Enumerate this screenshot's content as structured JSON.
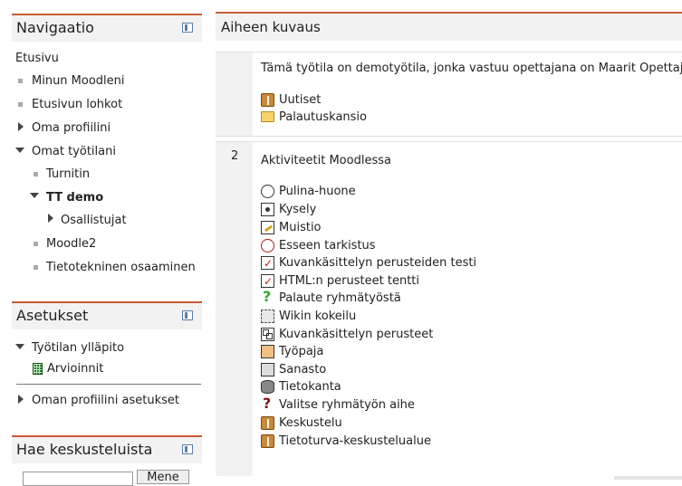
{
  "navigation": {
    "title": "Navigaatio",
    "items": [
      {
        "label": "Etusivu"
      },
      {
        "label": "Minun Moodleni"
      },
      {
        "label": "Etusivun lohkot"
      },
      {
        "label": "Oma profiilini"
      },
      {
        "label": "Omat työtilani"
      },
      {
        "label": "Turnitin"
      },
      {
        "label": "TT demo"
      },
      {
        "label": "Osallistujat"
      },
      {
        "label": "Moodle2"
      },
      {
        "label": "Tietotekninen osaaminen"
      }
    ]
  },
  "settings": {
    "title": "Asetukset",
    "items": [
      {
        "label": "Työtilan ylläpito"
      },
      {
        "label": "Arvioinnit"
      },
      {
        "label": "Oman profiilini asetukset"
      }
    ]
  },
  "search_forums": {
    "title": "Hae keskusteluista",
    "button_label": "Mene"
  },
  "main": {
    "title": "Aiheen kuvaus",
    "section0": {
      "summary": "Tämä työtila on demotyötila, jonka vastuu opettajana on Maarit Opettaja.",
      "activities": [
        {
          "label": "Uutiset",
          "icon": "forum-icon"
        },
        {
          "label": "Palautuskansio",
          "icon": "folder-icon"
        }
      ]
    },
    "section2": {
      "number": "2",
      "title": "Aktiviteetit Moodlessa",
      "activities": [
        {
          "label": "Pulina-huone",
          "icon": "chat-icon"
        },
        {
          "label": "Kysely",
          "icon": "choice-icon"
        },
        {
          "label": "Muistio",
          "icon": "journal-icon"
        },
        {
          "label": "Esseen tarkistus",
          "icon": "turnitin-icon"
        },
        {
          "label": "Kuvankäsittelyn perusteiden testi",
          "icon": "quiz-icon"
        },
        {
          "label": "HTML:n perusteet tentti",
          "icon": "quiz-icon"
        },
        {
          "label": "Palaute ryhmätyöstä",
          "icon": "feedback-icon"
        },
        {
          "label": "Wikin kokeilu",
          "icon": "wiki-icon"
        },
        {
          "label": "Kuvankäsittelyn perusteet",
          "icon": "lesson-icon"
        },
        {
          "label": "Työpaja",
          "icon": "workshop-icon"
        },
        {
          "label": "Sanasto",
          "icon": "glossary-icon"
        },
        {
          "label": "Tietokanta",
          "icon": "database-icon"
        },
        {
          "label": "Valitse ryhmätyön aihe",
          "icon": "question-icon"
        },
        {
          "label": "Keskustelu",
          "icon": "forum-icon"
        },
        {
          "label": "Tietoturva-keskustelualue",
          "icon": "forum-icon"
        }
      ]
    }
  },
  "colors": {
    "accent": "#c95a3a",
    "block_bg": "#f2f2f2"
  }
}
